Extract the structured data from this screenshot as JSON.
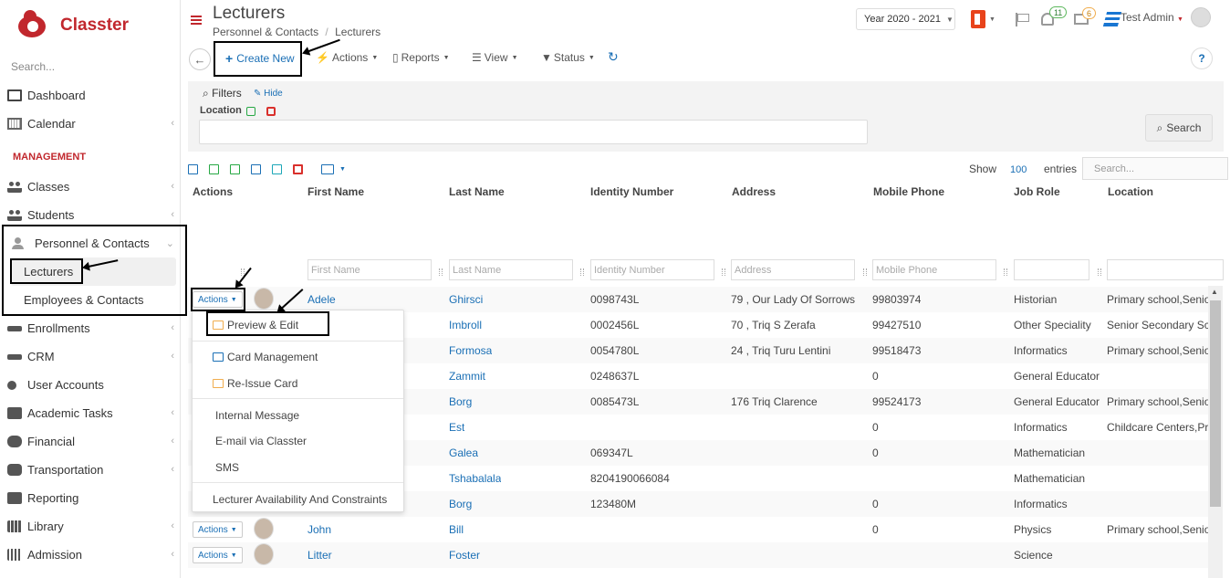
{
  "brand": {
    "name": "Classter"
  },
  "sidebar": {
    "search_placeholder": "Search...",
    "items_top": [
      {
        "label": "Dashboard",
        "icon": "monitor-icon"
      },
      {
        "label": "Calendar",
        "icon": "calendar-icon"
      }
    ],
    "section_label": "MANAGEMENT",
    "items_mgmt": [
      {
        "label": "Classes",
        "icon": "classes-icon"
      },
      {
        "label": "Students",
        "icon": "students-icon"
      },
      {
        "label": "Personnel & Contacts",
        "icon": "personnel-icon"
      }
    ],
    "sub_items": [
      {
        "label": "Lecturers"
      },
      {
        "label": "Employees & Contacts"
      }
    ],
    "items_bottom": [
      {
        "label": "Enrollments",
        "icon": "enrollments-icon"
      },
      {
        "label": "CRM",
        "icon": "crm-icon"
      },
      {
        "label": "User Accounts",
        "icon": "key-icon"
      },
      {
        "label": "Academic Tasks",
        "icon": "tasks-icon"
      },
      {
        "label": "Financial",
        "icon": "financial-icon"
      },
      {
        "label": "Transportation",
        "icon": "bus-icon"
      },
      {
        "label": "Reporting",
        "icon": "printer-icon"
      },
      {
        "label": "Library",
        "icon": "library-icon"
      },
      {
        "label": "Admission",
        "icon": "admission-icon"
      }
    ]
  },
  "header": {
    "title": "Lecturers",
    "breadcrumb_parent": "Personnel & Contacts",
    "breadcrumb_sep": "/",
    "breadcrumb_current": "Lecturers",
    "year": "Year 2020 - 2021",
    "notifications_count": "11",
    "messages_count": "6",
    "user_name": "Test Admin"
  },
  "toolbar": {
    "create_new": "Create New",
    "actions": "Actions",
    "reports": "Reports",
    "view": "View",
    "status": "Status",
    "help": "?"
  },
  "filters": {
    "title": "Filters",
    "hide": "Hide",
    "location_label": "Location",
    "search_button": "Search"
  },
  "table_controls": {
    "show_label": "Show",
    "show_value": "100",
    "entries_label": "entries",
    "search_placeholder": "Search..."
  },
  "columns": {
    "actions": "Actions",
    "first_name": "First Name",
    "last_name": "Last Name",
    "identity_number": "Identity Number",
    "address": "Address",
    "mobile_phone": "Mobile Phone",
    "job_role": "Job Role",
    "location": "Location"
  },
  "column_filters": {
    "first_name": "First Name",
    "last_name": "Last Name",
    "identity_number": "Identity Number",
    "address": "Address",
    "mobile_phone": "Mobile Phone"
  },
  "row_action_label": "Actions",
  "rows": [
    {
      "first": "Adele",
      "last": "Ghirsci",
      "id": "0098743L",
      "address": "79 , Our Lady Of Sorrows",
      "mobile": "99803974",
      "role": "Historian",
      "location": "Primary school,Senio"
    },
    {
      "first": "",
      "last": "Imbroll",
      "id": "0002456L",
      "address": "70 , Triq S Zerafa",
      "mobile": "99427510",
      "role": "Other Speciality",
      "location": "Senior Secondary Sch"
    },
    {
      "first": "",
      "last": "Formosa",
      "id": "0054780L",
      "address": "24 , Triq Turu Lentini",
      "mobile": "99518473",
      "role": "Informatics",
      "location": "Primary school,Senio"
    },
    {
      "first": "",
      "last": "Zammit",
      "id": "0248637L",
      "address": "",
      "mobile": "0",
      "role": "General Educator",
      "location": ""
    },
    {
      "first": "",
      "last": "Borg",
      "id": "0085473L",
      "address": "176 Triq Clarence",
      "mobile": "99524173",
      "role": "General Educator",
      "location": "Primary school,Senio"
    },
    {
      "first": "",
      "last": "Est",
      "id": "",
      "address": "",
      "mobile": "0",
      "role": "Informatics",
      "location": "Childcare Centers,Pri"
    },
    {
      "first": "",
      "last": "Galea",
      "id": "069347L",
      "address": "",
      "mobile": "0",
      "role": "Mathematician",
      "location": ""
    },
    {
      "first": "",
      "last": "Tshabalala",
      "id": "8204190066084",
      "address": "",
      "mobile": "",
      "role": "Mathematician",
      "location": ""
    },
    {
      "first": "",
      "last": "Borg",
      "id": "123480M",
      "address": "",
      "mobile": "0",
      "role": "Informatics",
      "location": ""
    },
    {
      "first": "John",
      "last": "Bill",
      "id": "",
      "address": "",
      "mobile": "0",
      "role": "Physics",
      "location": "Primary school,Senio"
    },
    {
      "first": "Litter",
      "last": "Foster",
      "id": "",
      "address": "",
      "mobile": "",
      "role": "Science",
      "location": ""
    }
  ],
  "dropdown": {
    "preview_edit": "Preview & Edit",
    "card_management": "Card Management",
    "reissue_card": "Re-Issue Card",
    "internal_message": "Internal Message",
    "email": "E-mail via Classter",
    "sms": "SMS",
    "availability": "Lecturer Availability And Constraints"
  },
  "colors": {
    "brand": "#c1272d",
    "link": "#1a6fb5"
  }
}
